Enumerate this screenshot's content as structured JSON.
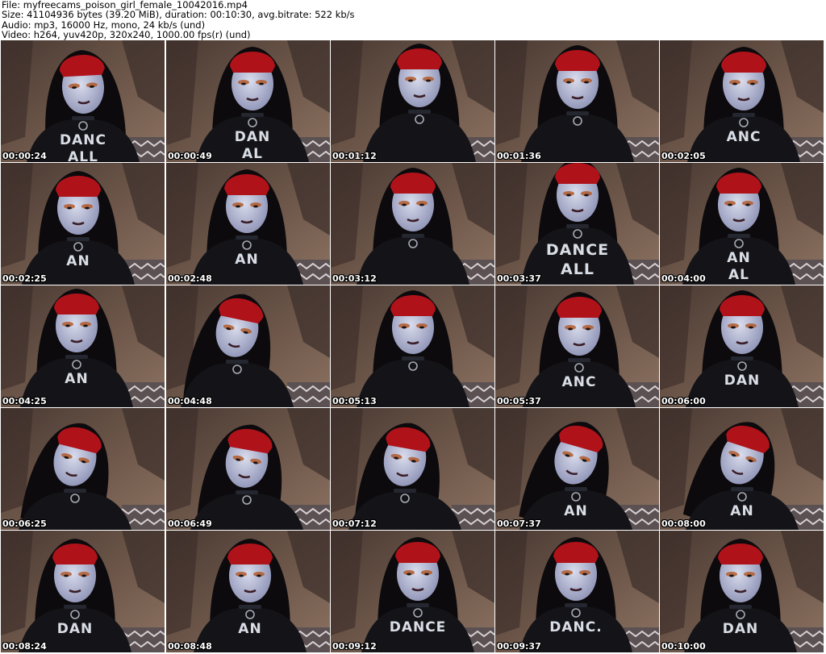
{
  "header": {
    "file_line": "File: myfreecams_poison_girl_female_10042016.mp4",
    "size_line": "Size: 41104936 bytes (39.20 MiB), duration: 00:10:30, avg.bitrate: 522 kb/s",
    "audio_line": "Audio: mp3, 16000 Hz, mono, 24 kb/s (und)",
    "video_line": "Video: h264, yuv420p, 320x240, 1000.00 fps(r) (und)"
  },
  "frames": [
    {
      "timestamp": "00:00:24",
      "shirt": "DANC\nALL"
    },
    {
      "timestamp": "00:00:49",
      "shirt": "DAN\nAL"
    },
    {
      "timestamp": "00:01:12",
      "shirt": ""
    },
    {
      "timestamp": "00:01:36",
      "shirt": ""
    },
    {
      "timestamp": "00:02:05",
      "shirt": "ANC"
    },
    {
      "timestamp": "00:02:25",
      "shirt": "AN"
    },
    {
      "timestamp": "00:02:48",
      "shirt": "AN"
    },
    {
      "timestamp": "00:03:12",
      "shirt": ""
    },
    {
      "timestamp": "00:03:37",
      "shirt": "DANCE\nALL"
    },
    {
      "timestamp": "00:04:00",
      "shirt": "AN\nAL"
    },
    {
      "timestamp": "00:04:25",
      "shirt": "AN"
    },
    {
      "timestamp": "00:04:48",
      "shirt": ""
    },
    {
      "timestamp": "00:05:13",
      "shirt": ""
    },
    {
      "timestamp": "00:05:37",
      "shirt": "ANC"
    },
    {
      "timestamp": "00:06:00",
      "shirt": "DAN"
    },
    {
      "timestamp": "00:06:25",
      "shirt": ""
    },
    {
      "timestamp": "00:06:49",
      "shirt": ""
    },
    {
      "timestamp": "00:07:12",
      "shirt": ""
    },
    {
      "timestamp": "00:07:37",
      "shirt": "AN"
    },
    {
      "timestamp": "00:08:00",
      "shirt": "AN"
    },
    {
      "timestamp": "00:08:24",
      "shirt": "DAN"
    },
    {
      "timestamp": "00:08:48",
      "shirt": "AN"
    },
    {
      "timestamp": "00:09:12",
      "shirt": "DANCE"
    },
    {
      "timestamp": "00:09:37",
      "shirt": "DANC."
    },
    {
      "timestamp": "00:10:00",
      "shirt": "DAN"
    }
  ],
  "colors": {
    "background": "#ffffff",
    "header_text": "#000000",
    "timestamp_text": "#ffffff",
    "timestamp_outline": "#000000",
    "hair": "#0c0a0c",
    "hair_dye": "#b0121a",
    "skin": "#b9bdd6",
    "shirt": "#141418",
    "wall": "#6b5548"
  }
}
